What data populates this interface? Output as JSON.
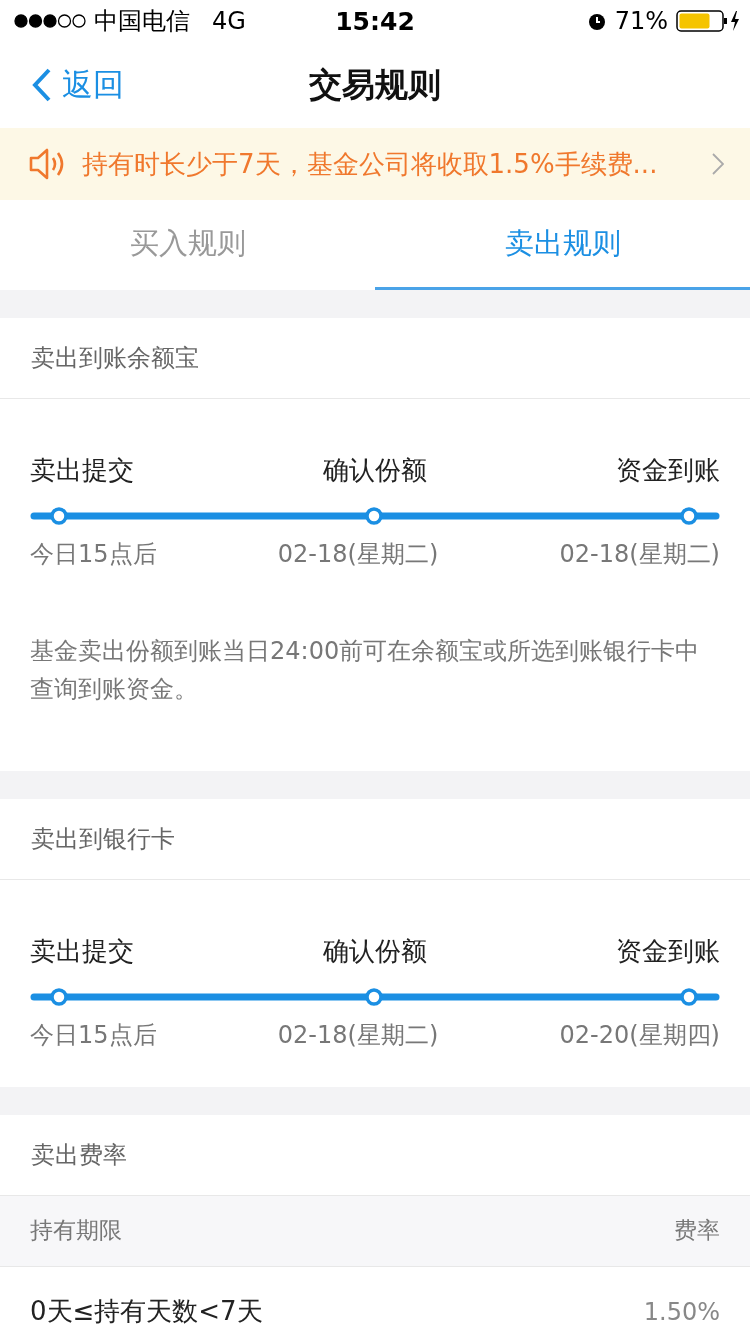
{
  "status_bar": {
    "carrier": "中国电信",
    "network": "4G",
    "time": "15:42",
    "battery": "71%"
  },
  "nav": {
    "back": "返回",
    "title": "交易规则"
  },
  "notice": {
    "text": "持有时长少于7天，基金公司将收取1.5%手续费..."
  },
  "tabs": [
    {
      "label": "买入规则",
      "selected": false
    },
    {
      "label": "卖出规则",
      "selected": true
    }
  ],
  "sections": [
    {
      "title": "卖出到账余额宝",
      "steps": [
        {
          "label": "卖出提交",
          "date": "今日15点后"
        },
        {
          "label": "确认份额",
          "date": "02-18(星期二)"
        },
        {
          "label": "资金到账",
          "date": "02-18(星期二)"
        }
      ],
      "note": "基金卖出份额到账当日24:00前可在余额宝或所选到账银行卡中查询到账资金。"
    },
    {
      "title": "卖出到银行卡",
      "steps": [
        {
          "label": "卖出提交",
          "date": "今日15点后"
        },
        {
          "label": "确认份额",
          "date": "02-18(星期二)"
        },
        {
          "label": "资金到账",
          "date": "02-20(星期四)"
        }
      ]
    }
  ],
  "fees": {
    "title": "卖出费率",
    "columns": [
      "持有期限",
      "费率"
    ],
    "rows": [
      [
        "0天≤持有天数<7天",
        "1.50%"
      ]
    ]
  }
}
